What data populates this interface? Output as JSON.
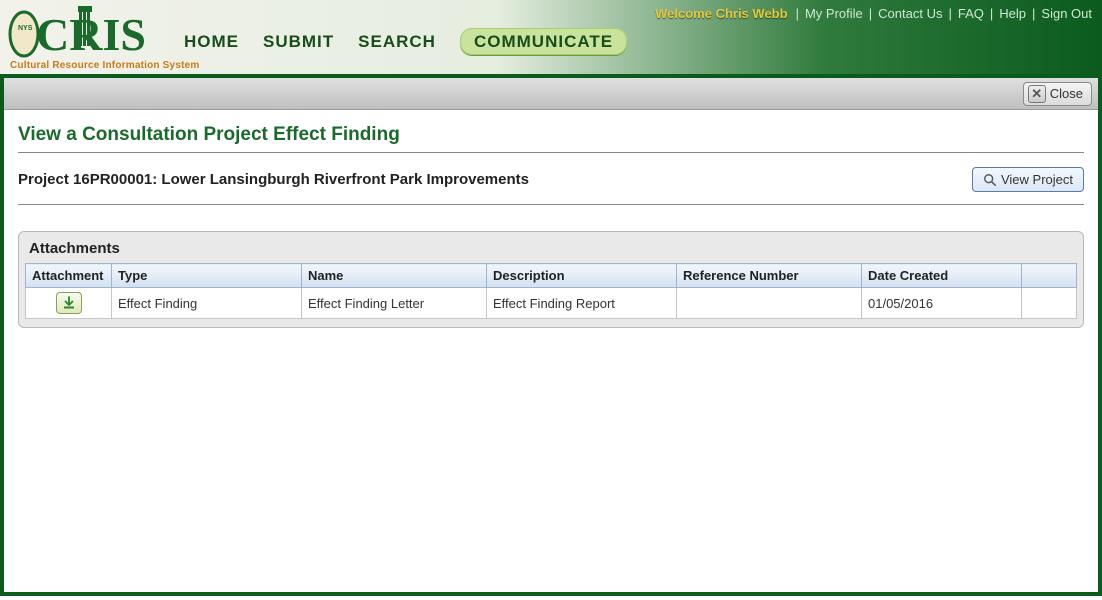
{
  "branding": {
    "name": "CRIS",
    "subtitle": "Cultural Resource Information System"
  },
  "nav": {
    "items": [
      {
        "label": "HOME",
        "active": false
      },
      {
        "label": "SUBMIT",
        "active": false
      },
      {
        "label": "SEARCH",
        "active": false
      },
      {
        "label": "COMMUNICATE",
        "active": true
      }
    ]
  },
  "top_links": {
    "welcome_prefix": "Welcome ",
    "user_name": "Chris Webb",
    "links": [
      "My Profile",
      "Contact Us",
      "FAQ",
      "Help",
      "Sign Out"
    ]
  },
  "toolbar": {
    "close_label": "Close"
  },
  "page": {
    "title": "View a Consultation Project Effect Finding",
    "project_line": "Project 16PR00001: Lower Lansingburgh Riverfront Park Improvements",
    "view_project_label": "View Project"
  },
  "attachments": {
    "heading": "Attachments",
    "columns": [
      "Attachment",
      "Type",
      "Name",
      "Description",
      "Reference Number",
      "Date Created"
    ],
    "rows": [
      {
        "type": "Effect Finding",
        "name": "Effect Finding Letter",
        "description": "Effect Finding Report",
        "reference_number": "",
        "date_created": "01/05/2016"
      }
    ]
  }
}
